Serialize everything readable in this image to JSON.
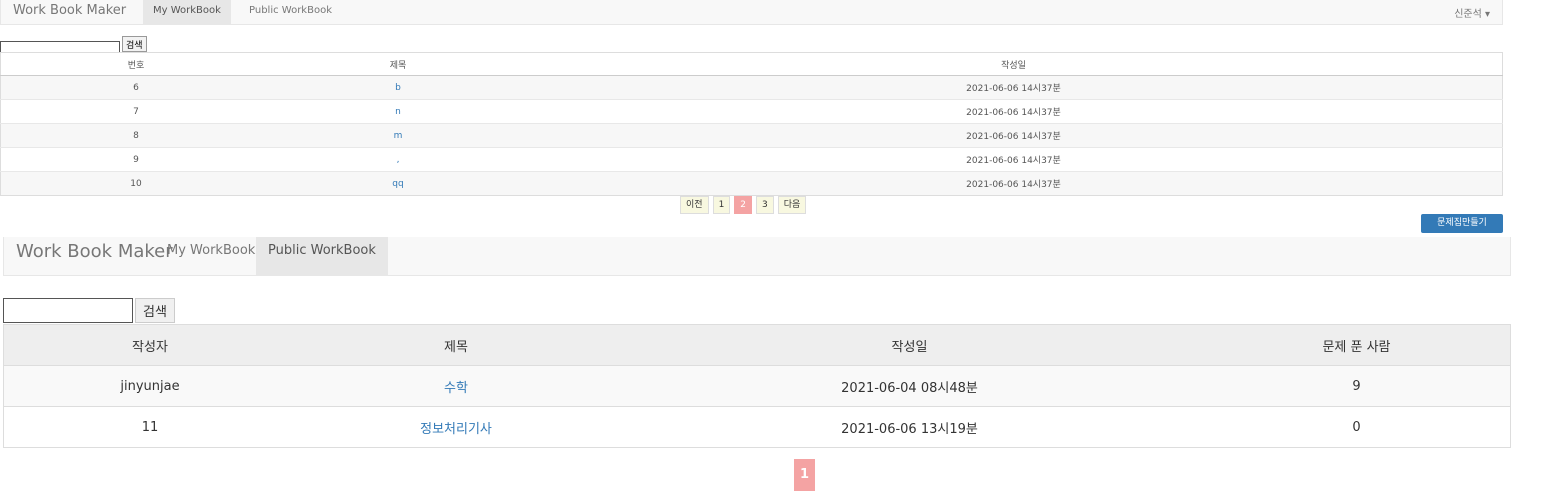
{
  "top": {
    "brand": "Work Book Maker",
    "tabs": [
      "My WorkBook",
      "Public WorkBook"
    ],
    "user": "신준석 ▾",
    "search_button": "검색",
    "columns": [
      "번호",
      "제목",
      "작성일"
    ],
    "rows": [
      {
        "num": "6",
        "title": "b",
        "date": "2021-06-06 14시37분"
      },
      {
        "num": "7",
        "title": "n",
        "date": "2021-06-06 14시37분"
      },
      {
        "num": "8",
        "title": "m",
        "date": "2021-06-06 14시37분"
      },
      {
        "num": "9",
        "title": ",",
        "date": "2021-06-06 14시37분"
      },
      {
        "num": "10",
        "title": "qq",
        "date": "2021-06-06 14시37분"
      }
    ],
    "pager": {
      "prev": "이전",
      "pages": [
        "1",
        "2",
        "3"
      ],
      "current": "2",
      "next": "다음"
    },
    "new_button": "문제집만들기"
  },
  "bottom": {
    "brand": "Work Book Maker",
    "tabs": [
      "My WorkBook",
      "Public WorkBook"
    ],
    "search_button": "검색",
    "columns": [
      "작성자",
      "제목",
      "작성일",
      "문제 푼 사람"
    ],
    "rows": [
      {
        "author": "jinyunjae",
        "title": "수학",
        "date": "2021-06-04 08시48분",
        "solvers": "9"
      },
      {
        "author": "11",
        "title": "정보처리기사",
        "date": "2021-06-06 13시19분",
        "solvers": "0"
      }
    ],
    "pager": {
      "pages": [
        "1"
      ]
    }
  }
}
